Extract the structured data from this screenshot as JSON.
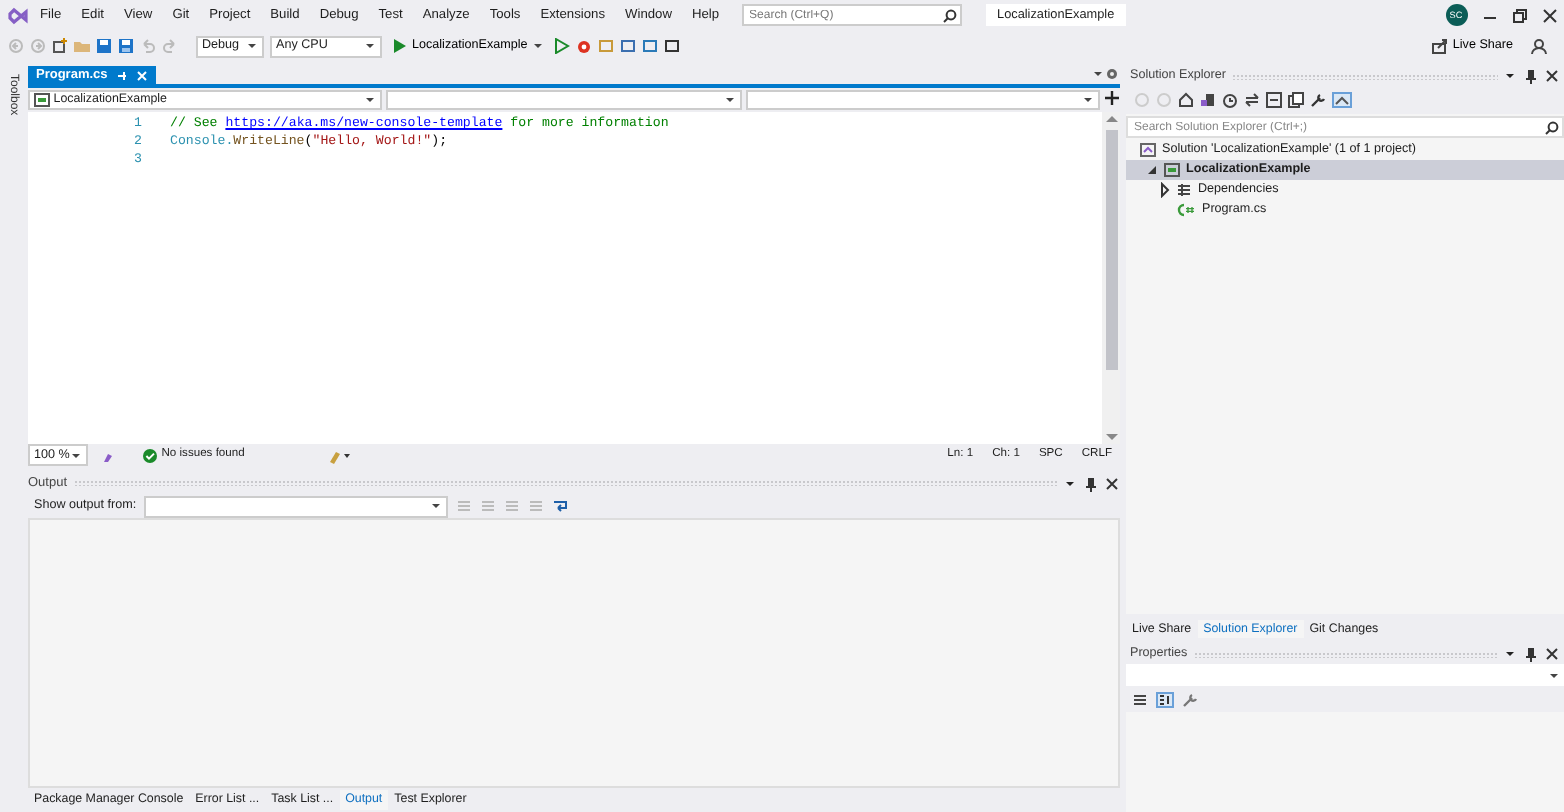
{
  "window": {
    "title": "LocalizationExample",
    "search": {
      "placeholder": "Search (Ctrl+Q)"
    },
    "account_initials": "SC",
    "live_share": "Live Share"
  },
  "menu": [
    "File",
    "Edit",
    "View",
    "Git",
    "Project",
    "Build",
    "Debug",
    "Test",
    "Analyze",
    "Tools",
    "Extensions",
    "Window",
    "Help"
  ],
  "toolbar": {
    "configuration": "Debug",
    "platform": "Any CPU",
    "start_target": "LocalizationExample"
  },
  "side_strip": {
    "label": "Toolbox"
  },
  "editor": {
    "tabs": [
      {
        "label": "Program.cs",
        "selected": true
      }
    ],
    "nav": {
      "project": "LocalizationExample"
    },
    "lines": [
      {
        "number": "1",
        "tokens": [
          {
            "kind": "comment",
            "text": "// See "
          },
          {
            "kind": "link",
            "text": "https://aka.ms/new-console-template"
          },
          {
            "kind": "comment",
            "text": " for more information"
          }
        ]
      },
      {
        "number": "2",
        "tokens": [
          {
            "kind": "type",
            "text": "Console."
          },
          {
            "kind": "method",
            "text": "WriteLine"
          },
          {
            "kind": "plain",
            "text": "("
          },
          {
            "kind": "string",
            "text": "\"Hello, World!\""
          },
          {
            "kind": "plain",
            "text": ");"
          }
        ]
      },
      {
        "number": "3"
      }
    ],
    "status": {
      "zoom": "100 %",
      "issues": "No issues found",
      "line": "Ln: 1",
      "char": "Ch: 1",
      "spacing": "SPC",
      "ending": "CRLF"
    }
  },
  "output": {
    "title": "Output",
    "show_from": "Show output from:"
  },
  "bottom_tabs": [
    {
      "label": "Package Manager Console",
      "selected": false
    },
    {
      "label": "Error List ...",
      "selected": false
    },
    {
      "label": "Task List ...",
      "selected": false
    },
    {
      "label": "Output",
      "selected": true
    },
    {
      "label": "Test Explorer",
      "selected": false
    }
  ],
  "solution_explorer": {
    "title": "Solution Explorer",
    "search": {
      "placeholder": "Search Solution Explorer (Ctrl+;)"
    },
    "tree": [
      {
        "label": "Solution 'LocalizationExample' (1 of 1 project)",
        "kind": "solution",
        "selected": false,
        "children": [
          {
            "label": "LocalizationExample",
            "kind": "project",
            "selected": true,
            "expanded": true,
            "children": [
              {
                "label": "Dependencies",
                "kind": "dependencies",
                "selected": false,
                "expanded": false
              },
              {
                "label": "Program.cs",
                "kind": "csharp",
                "selected": false
              }
            ]
          }
        ]
      }
    ]
  },
  "right_tabs": [
    {
      "label": "Live Share",
      "selected": false
    },
    {
      "label": "Solution Explorer",
      "selected": true
    },
    {
      "label": "Git Changes",
      "selected": false
    }
  ],
  "properties": {
    "title": "Properties"
  }
}
